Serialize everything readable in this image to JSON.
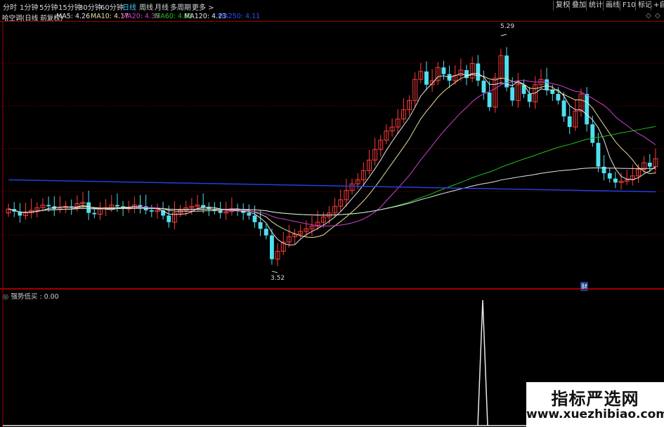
{
  "toolbar": {
    "periods": [
      "分时",
      "1分钟",
      "5分钟",
      "15分钟",
      "30分钟",
      "60分钟",
      "日线",
      "周线",
      "月线",
      "多周期",
      "更多 >"
    ],
    "active_period": "日线",
    "right_buttons": [
      "复权",
      "叠加",
      "统计",
      "画线",
      "F10",
      "标记",
      "+自"
    ]
  },
  "info": {
    "title": "哈空调(日线 前复权)",
    "ma5": "MA5: 4.26",
    "ma10": "MA10: 4.17",
    "ma20": "MA20: 4.35",
    "ma60": "MA60: 4.61",
    "ma120": "MA120: 4.23",
    "ma250": "MA250: 4.11"
  },
  "colors": {
    "up": "#ff3b3b",
    "down": "#4fe0f0",
    "ma5": "#e8e8e8",
    "ma10": "#e8e0a0",
    "ma20": "#d040d0",
    "ma60": "#20c020",
    "ma120": "#e8e8e8",
    "ma250": "#2040e0",
    "grid": "#8b0000"
  },
  "annotations": {
    "high": "5.29",
    "low": "3.52",
    "fin_marker": "财"
  },
  "indicator": {
    "label": "强势低买 : 0.00"
  },
  "watermark": {
    "line1": "指标严选网",
    "line2": "www.xuezhibiao.com"
  },
  "chart_data": {
    "type": "candlestick",
    "high": 5.29,
    "low": 3.52,
    "ylim": [
      3.45,
      5.38
    ],
    "grid": true,
    "closes": [
      3.98,
      3.96,
      3.93,
      3.95,
      3.97,
      3.99,
      4.01,
      4.0,
      3.98,
      3.99,
      4.0,
      3.99,
      4.02,
      4.03,
      3.95,
      3.94,
      3.98,
      3.99,
      4.01,
      4.0,
      3.98,
      3.99,
      4.01,
      4.0,
      3.97,
      3.96,
      3.97,
      3.93,
      3.88,
      3.95,
      3.97,
      3.99,
      4.0,
      4.01,
      3.99,
      3.98,
      3.97,
      3.95,
      3.96,
      3.98,
      3.97,
      3.95,
      3.93,
      3.88,
      3.83,
      3.78,
      3.6,
      3.66,
      3.73,
      3.77,
      3.79,
      3.81,
      3.83,
      3.85,
      3.88,
      3.92,
      3.95,
      4.0,
      4.05,
      4.12,
      4.17,
      4.2,
      4.27,
      4.35,
      4.43,
      4.5,
      4.57,
      4.6,
      4.66,
      4.73,
      4.8,
      4.96,
      5.02,
      4.92,
      4.95,
      5.05,
      5.0,
      4.95,
      4.99,
      5.03,
      4.97,
      5.08,
      4.95,
      4.86,
      4.75,
      4.97,
      5.14,
      4.9,
      4.8,
      4.92,
      4.85,
      4.79,
      4.92,
      4.96,
      4.88,
      4.85,
      4.8,
      4.68,
      4.6,
      4.72,
      4.85,
      4.62,
      4.48,
      4.3,
      4.25,
      4.21,
      4.18,
      4.19,
      4.2,
      4.23,
      4.28,
      4.33,
      4.3,
      4.36
    ],
    "opens": [
      3.95,
      3.98,
      3.96,
      3.93,
      3.95,
      3.97,
      3.99,
      4.01,
      4.0,
      3.98,
      3.99,
      4.0,
      3.99,
      4.02,
      4.03,
      3.95,
      3.94,
      3.98,
      3.99,
      4.01,
      4.0,
      3.98,
      3.99,
      4.01,
      4.0,
      3.97,
      3.96,
      3.97,
      3.93,
      3.88,
      3.95,
      3.97,
      3.99,
      4.0,
      4.01,
      3.99,
      3.98,
      3.97,
      3.95,
      3.96,
      3.98,
      3.97,
      3.95,
      3.93,
      3.88,
      3.83,
      3.78,
      3.6,
      3.66,
      3.73,
      3.77,
      3.79,
      3.81,
      3.83,
      3.85,
      3.88,
      3.92,
      3.95,
      4.0,
      4.05,
      4.12,
      4.17,
      4.2,
      4.27,
      4.35,
      4.43,
      4.5,
      4.57,
      4.6,
      4.66,
      4.73,
      4.8,
      4.96,
      5.02,
      4.92,
      4.95,
      5.05,
      5.0,
      4.95,
      4.99,
      5.03,
      4.97,
      5.08,
      4.95,
      4.86,
      4.75,
      4.97,
      5.14,
      4.9,
      4.8,
      4.92,
      4.85,
      4.79,
      4.92,
      4.96,
      4.88,
      4.85,
      4.8,
      4.68,
      4.6,
      4.72,
      4.85,
      4.62,
      4.48,
      4.3,
      4.25,
      4.21,
      4.18,
      4.19,
      4.2,
      4.23,
      4.28,
      4.33,
      4.3
    ]
  }
}
